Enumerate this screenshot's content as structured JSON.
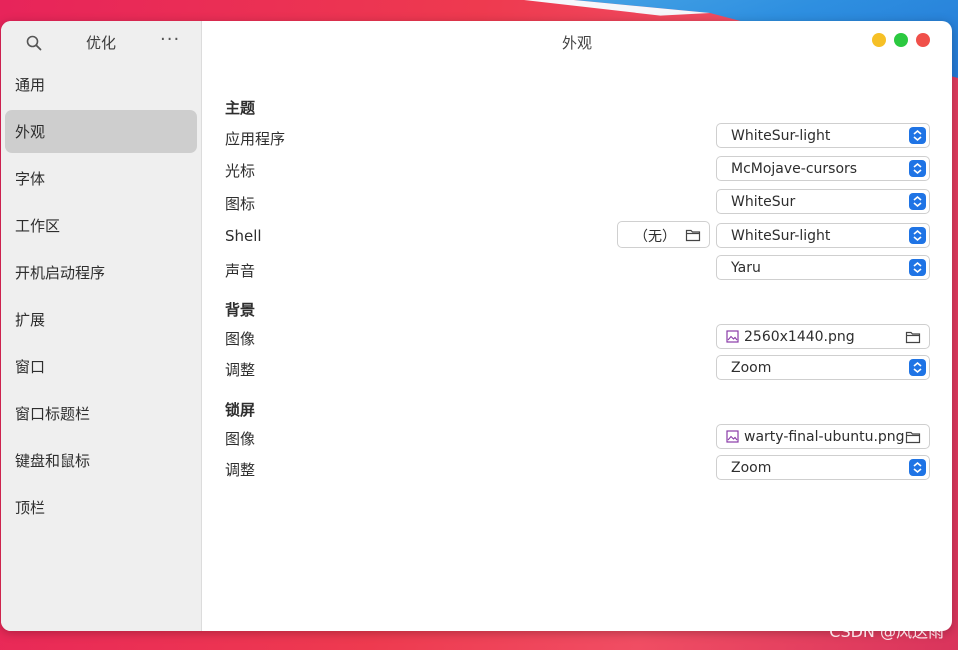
{
  "sidebar": {
    "title": "优化",
    "more_label": "···",
    "items": [
      {
        "label": "通用",
        "selected": false
      },
      {
        "label": "外观",
        "selected": true
      },
      {
        "label": "字体",
        "selected": false
      },
      {
        "label": "工作区",
        "selected": false
      },
      {
        "label": "开机启动程序",
        "selected": false
      },
      {
        "label": "扩展",
        "selected": false
      },
      {
        "label": "窗口",
        "selected": false
      },
      {
        "label": "窗口标题栏",
        "selected": false
      },
      {
        "label": "键盘和鼠标",
        "selected": false
      },
      {
        "label": "顶栏",
        "selected": false
      }
    ]
  },
  "main": {
    "title": "外观",
    "themes": {
      "title": "主题",
      "applications_label": "应用程序",
      "applications_value": "WhiteSur-light",
      "cursor_label": "光标",
      "cursor_value": "McMojave-cursors",
      "icons_label": "图标",
      "icons_value": "WhiteSur",
      "shell_label": "Shell",
      "shell_none_label": "（无）",
      "shell_value": "WhiteSur-light",
      "sound_label": "声音",
      "sound_value": "Yaru"
    },
    "background": {
      "title": "背景",
      "image_label": "图像",
      "image_value": "2560x1440.png",
      "adjust_label": "调整",
      "adjust_value": "Zoom"
    },
    "lockscreen": {
      "title": "锁屏",
      "image_label": "图像",
      "image_value": "warty-final-ubuntu.png",
      "adjust_label": "调整",
      "adjust_value": "Zoom"
    }
  },
  "window_controls": {
    "minimize_color": "#f6c026",
    "maximize_color": "#2bc940",
    "close_color": "#f0504a"
  },
  "icons": {
    "search": "search-icon",
    "more": "more-icon",
    "spin": "spin-arrows-icon",
    "folder": "folder-icon",
    "image": "image-file-icon"
  },
  "accent_color": "#1f74e5",
  "watermark": "CSDN @风送雨"
}
